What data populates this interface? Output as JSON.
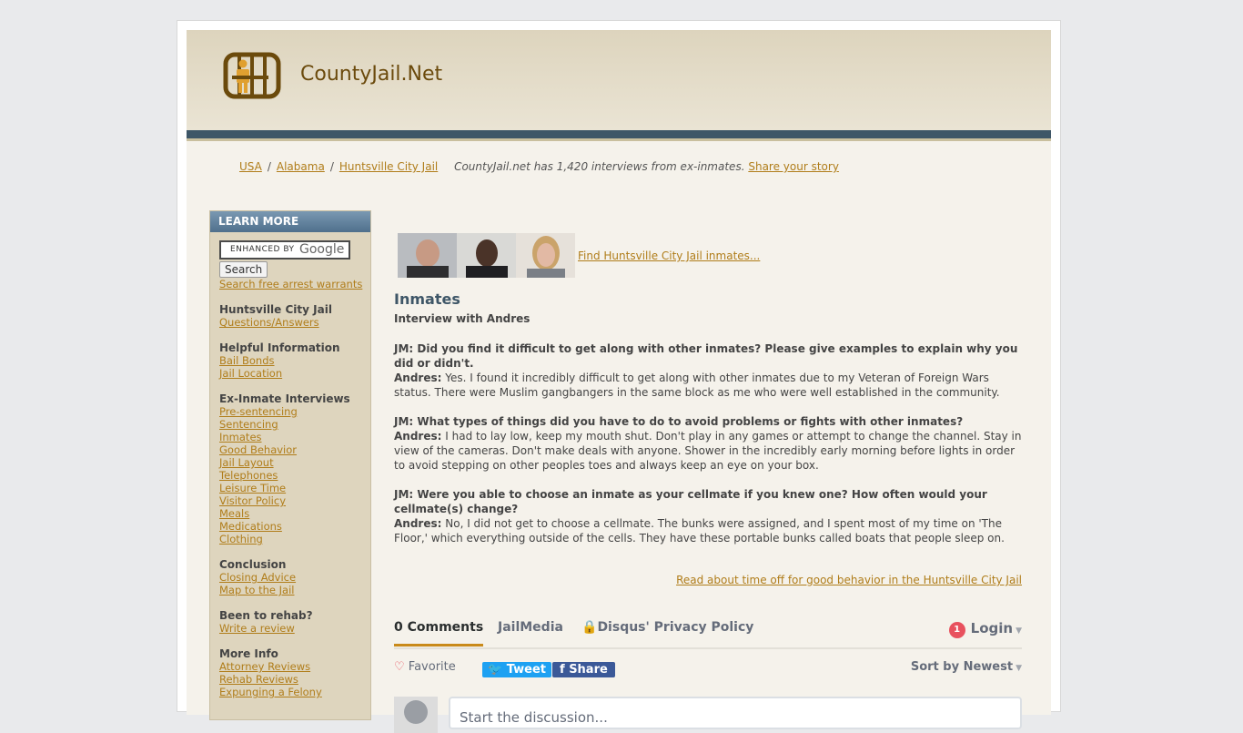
{
  "site": {
    "title": "CountyJail.Net"
  },
  "breadcrumb": {
    "items": [
      "USA",
      "Alabama",
      "Huntsville City Jail"
    ],
    "separator": "/",
    "note": "CountyJail.net has 1,420 interviews from ex-inmates.",
    "share_link": "Share your story"
  },
  "sidebar": {
    "header": "LEARN MORE",
    "search_placeholder": "ENHANCED BY",
    "search_brand": "Google",
    "search_button": "Search",
    "warrants_link": "Search free arrest warrants",
    "groups": [
      {
        "title": "Huntsville City Jail",
        "links": [
          "Questions/Answers"
        ]
      },
      {
        "title": "Helpful Information",
        "links": [
          "Bail Bonds",
          "Jail Location"
        ]
      },
      {
        "title": "Ex-Inmate Interviews",
        "links": [
          "Pre-sentencing",
          "Sentencing",
          "Inmates",
          "Good Behavior",
          "Jail Layout",
          "Telephones",
          "Leisure Time",
          "Visitor Policy",
          "Meals",
          "Medications",
          "Clothing"
        ]
      },
      {
        "title": "Conclusion",
        "links": [
          "Closing Advice",
          "Map to the Jail"
        ]
      },
      {
        "title": "Been to rehab?",
        "links": [
          "Write a review"
        ]
      },
      {
        "title": "More Info",
        "links": [
          "Attorney Reviews",
          "Rehab Reviews",
          "Expunging a Felony"
        ]
      }
    ]
  },
  "main": {
    "find_inmates_link": "Find Huntsville City Jail inmates...",
    "section_title": "Inmates",
    "interview_title": "Interview with Andres",
    "qa": [
      {
        "q": "JM: Did you find it difficult to get along with other inmates? Please give examples to explain why you did or didn't.",
        "label": "Andres:",
        "a": "Yes. I found it incredibly difficult to get along with other inmates due to my Veteran of Foreign Wars status. There were Muslim gangbangers in the same block as me who were well established in the community."
      },
      {
        "q": "JM: What types of things did you have to do to avoid problems or fights with other inmates?",
        "label": "Andres:",
        "a": "I had to lay low, keep my mouth shut. Don't play in any games or attempt to change the channel. Stay in view of the cameras. Don't make deals with anyone. Shower in the incredibly early morning before lights in order to avoid stepping on other peoples toes and always keep an eye on your box."
      },
      {
        "q": "JM: Were you able to choose an inmate as your cellmate if you knew one? How often would your cellmate(s) change?",
        "label": "Andres:",
        "a": "No, I did not get to choose a cellmate. The bunks were assigned, and I spent most of my time on 'The Floor,' which everything outside of the cells. They have these portable bunks called boats that people sleep on."
      }
    ],
    "good_behavior_link": "Read about time off for good behavior in the Huntsville City Jail"
  },
  "disqus": {
    "tab_comments": "0 Comments",
    "tab_community": "JailMedia",
    "tab_privacy": "Disqus' Privacy Policy",
    "login_badge": "1",
    "login": "Login",
    "favorite": "Favorite",
    "tweet": "Tweet",
    "share": "Share",
    "sort": "Sort by Newest",
    "compose_placeholder": "Start the discussion..."
  },
  "colors": {
    "header_bar": "#3e5667",
    "link": "#b07d1a",
    "sidebar_bg": "#ded5be",
    "accent": "#c98a1a"
  }
}
